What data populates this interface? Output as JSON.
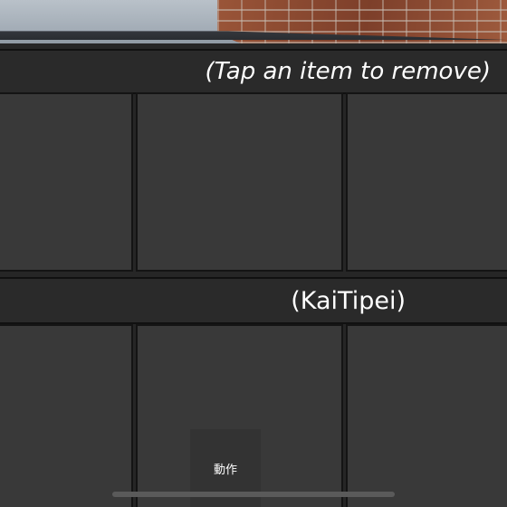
{
  "backpack": {
    "hint_text": "(Tap an item to remove)",
    "owner_name": "(KaiTipei)",
    "top_row_slots": [
      "",
      "",
      ""
    ],
    "bottom_row_slots": [
      "",
      "",
      ""
    ]
  },
  "controls": {
    "action_label": "動作"
  },
  "colors": {
    "panel_bg": "#262626",
    "slot_bg": "#393939",
    "slot_border": "#141414",
    "text": "#ffffff"
  }
}
